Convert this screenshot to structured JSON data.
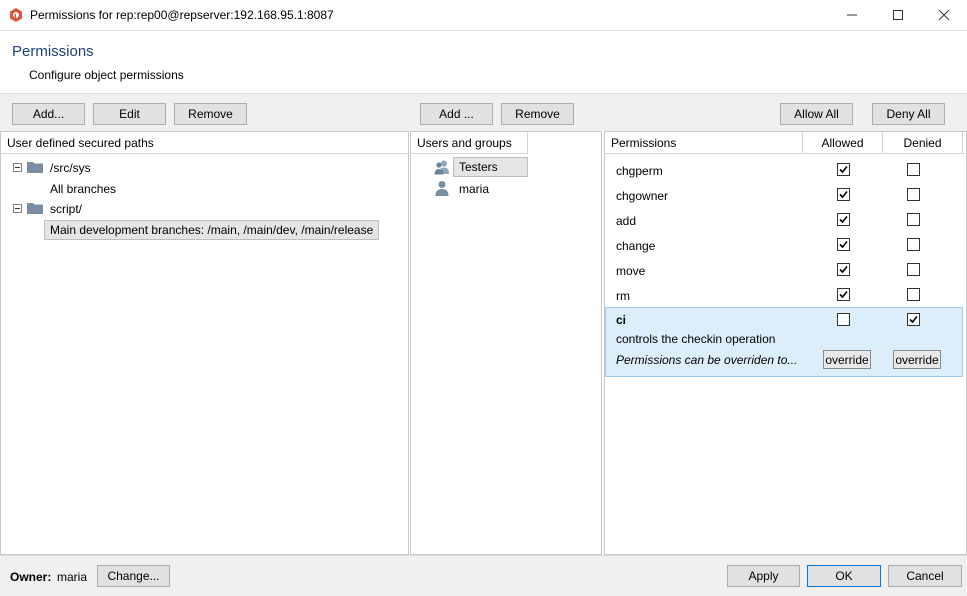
{
  "window": {
    "title": "Permissions for rep:rep00@repserver:192.168.95.1:8087",
    "minimize_icon": "minimize-icon",
    "maximize_icon": "maximize-icon",
    "close_icon": "close-icon"
  },
  "header": {
    "title": "Permissions",
    "subtitle": "Configure object permissions"
  },
  "toolbar": {
    "paths_add": "Add...",
    "paths_edit": "Edit",
    "paths_remove": "Remove",
    "users_add": "Add ...",
    "users_remove": "Remove",
    "allow_all": "Allow All",
    "deny_all": "Deny All"
  },
  "paths_panel": {
    "header": "User defined secured paths",
    "items": [
      {
        "label": "/src/sys",
        "child": "All branches"
      },
      {
        "label": "script/",
        "child": "Main development branches: /main, /main/dev, /main/release"
      }
    ]
  },
  "users_panel": {
    "header": "Users and groups",
    "items": [
      {
        "label": "Testers",
        "type": "group"
      },
      {
        "label": "maria",
        "type": "user"
      }
    ]
  },
  "permissions_panel": {
    "headers": {
      "name": "Permissions",
      "allowed": "Allowed",
      "denied": "Denied"
    },
    "rows": [
      {
        "name": "chgperm",
        "allowed": true,
        "denied": false
      },
      {
        "name": "chgowner",
        "allowed": true,
        "denied": false
      },
      {
        "name": "add",
        "allowed": true,
        "denied": false
      },
      {
        "name": "change",
        "allowed": true,
        "denied": false
      },
      {
        "name": "move",
        "allowed": true,
        "denied": false
      },
      {
        "name": "rm",
        "allowed": true,
        "denied": false
      }
    ],
    "selected": {
      "name": "ci",
      "allowed": false,
      "denied": true,
      "description": "controls the checkin operation",
      "override_note": "Permissions can be overriden to...",
      "override_allowed": "override",
      "override_denied": "override"
    }
  },
  "footer": {
    "owner_label": "Owner:",
    "owner_value": "maria",
    "change_button": "Change...",
    "apply_button": "Apply",
    "ok_button": "OK",
    "cancel_button": "Cancel"
  },
  "colors": {
    "accent": "#1f3f7a",
    "selection": "#ddeefb",
    "app_icon": "#e0543c"
  }
}
